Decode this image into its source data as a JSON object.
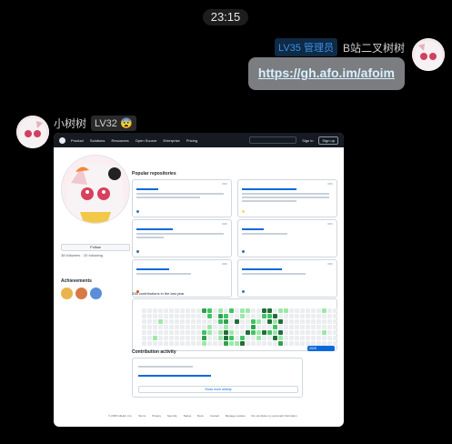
{
  "chat": {
    "timestamp": "23:15",
    "message1": {
      "level_badge": "LV35 管理员",
      "sender": "B站二叉树树",
      "link": "https://gh.afo.im/afoim"
    },
    "message2": {
      "sender": "小树树",
      "level_badge": "LV32",
      "emoji": "😨"
    }
  },
  "screenshot": {
    "nav": [
      "Product",
      "Solutions",
      "Resources",
      "Open Source",
      "Enterprise",
      "Pricing"
    ],
    "sign_in": "Sign in",
    "sign_up": "Sign up",
    "follow": "Follow",
    "followers": "38 followers · 20 following",
    "popular_repos": "Popular repositories",
    "achievements": "Achievements",
    "contributions": "336 contributions in the last year",
    "activity": "Contribution activity",
    "year": "2025",
    "show_more": "Show more activity",
    "footer": [
      "© 2025 GitHub, Inc.",
      "Terms",
      "Privacy",
      "Security",
      "Status",
      "Docs",
      "Contact",
      "Manage cookies",
      "Do not share my personal information"
    ]
  }
}
